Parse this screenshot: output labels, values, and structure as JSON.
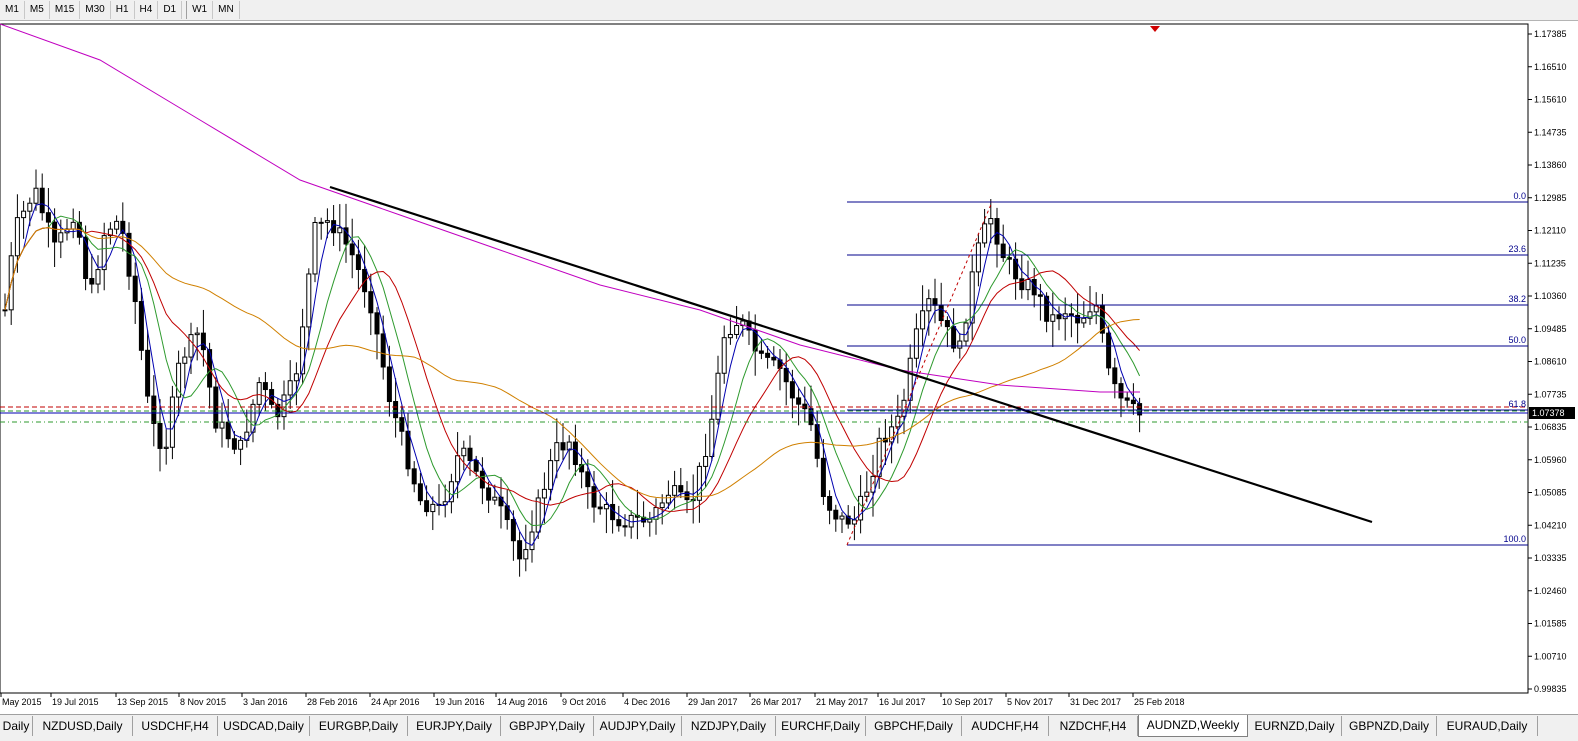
{
  "toolbar": {
    "timeframes": [
      "M1",
      "M5",
      "M15",
      "M30",
      "H1",
      "H4",
      "D1",
      "W1",
      "MN"
    ]
  },
  "chart_data": {
    "type": "candlestick",
    "symbol": "AUDNZD",
    "timeframe": "Weekly",
    "price_label": "1.07378",
    "y_axis_ticks": [
      "1.17385",
      "1.16510",
      "1.15610",
      "1.14735",
      "1.13860",
      "1.12985",
      "1.12110",
      "1.11235",
      "1.10360",
      "1.09485",
      "1.08610",
      "1.07735",
      "1.06835",
      "1.05960",
      "1.05085",
      "1.04210",
      "1.03335",
      "1.02460",
      "1.01585",
      "1.00710",
      "0.99835"
    ],
    "x_axis_ticks": [
      "May 2015",
      "19 Jul 2015",
      "13 Sep 2015",
      "8 Nov 2015",
      "3 Jan 2016",
      "28 Feb 2016",
      "24 Apr 2016",
      "19 Jun 2016",
      "14 Aug 2016",
      "9 Oct 2016",
      "4 Dec 2016",
      "29 Jan 2017",
      "26 Mar 2017",
      "21 May 2017",
      "16 Jul 2017",
      "10 Sep 2017",
      "5 Nov 2017",
      "31 Dec 2017",
      "25 Feb 2018"
    ],
    "fibonacci_labels": [
      "0.0",
      "23.6",
      "38.2",
      "50.0",
      "61.8",
      "100.0"
    ],
    "colors": {
      "candle": "#000000",
      "ma_blue": "#0000b0",
      "ma_green": "#2e9a2e",
      "ma_red": "#c00000",
      "ma_orange": "#d08000",
      "ma_magenta": "#c000c0",
      "fib": "#00008b",
      "trendline": "#000000"
    }
  },
  "symbol_tabs": [
    "Daily",
    "NZDUSD,Daily",
    "USDCHF,H4",
    "USDCAD,Daily",
    "EURGBP,Daily",
    "EURJPY,Daily",
    "GBPJPY,Daily",
    "AUDJPY,Daily",
    "NZDJPY,Daily",
    "EURCHF,Daily",
    "GBPCHF,Daily",
    "AUDCHF,H4",
    "NZDCHF,H4",
    "AUDNZD,Weekly",
    "EURNZD,Daily",
    "GBPNZD,Daily",
    "EURAUD,Daily"
  ],
  "active_tab": "AUDNZD,Weekly"
}
